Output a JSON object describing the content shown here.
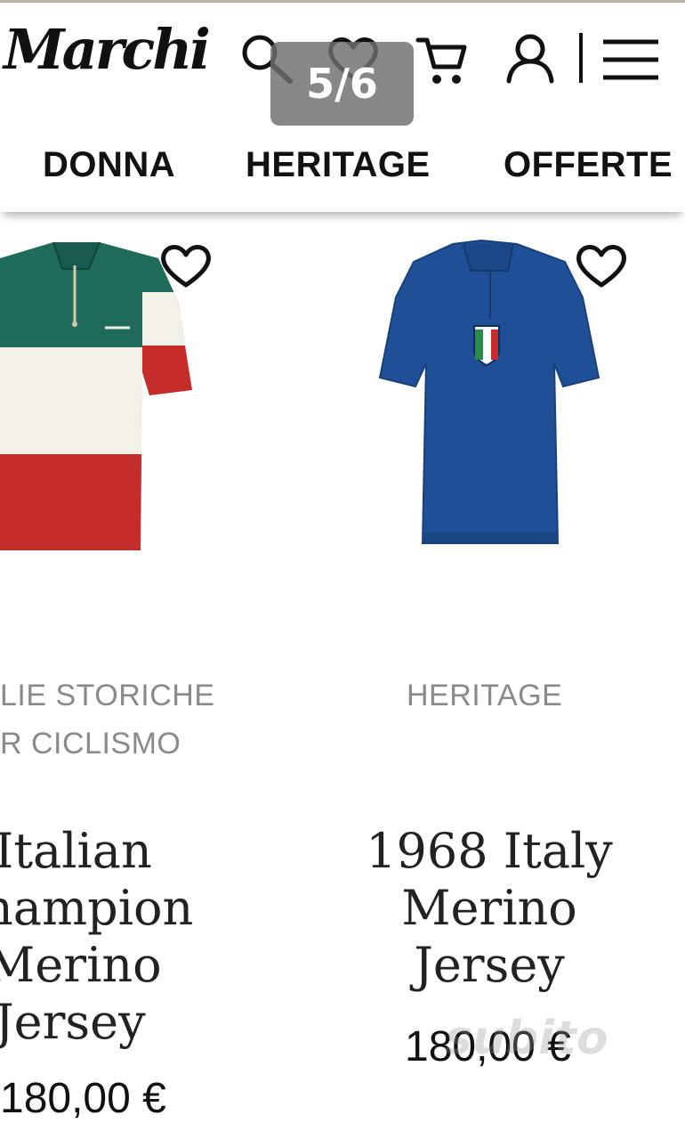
{
  "header": {
    "logo": "Marchi",
    "counter": "5/6",
    "icons": [
      "search-icon",
      "heart-icon",
      "cart-icon",
      "user-icon",
      "menu-icon"
    ]
  },
  "nav": {
    "items": [
      "DONNA",
      "HERITAGE",
      "OFFERTE"
    ]
  },
  "products": [
    {
      "category_line1": "LIE STORICHE",
      "category_line2": "R CICLISMO",
      "name": [
        "Italian",
        "hampion",
        "Merino",
        "Jersey"
      ],
      "price": "180,00 €",
      "colors": {
        "green": "#1f6b5c",
        "white": "#f3f0e8",
        "red": "#c42d2a"
      }
    },
    {
      "category_line1": "HERITAGE",
      "name": [
        "1968 Italy",
        "Merino",
        "Jersey"
      ],
      "price": "180,00 €",
      "colors": {
        "blue": "#1f4f96"
      }
    }
  ],
  "watermark": "subito"
}
